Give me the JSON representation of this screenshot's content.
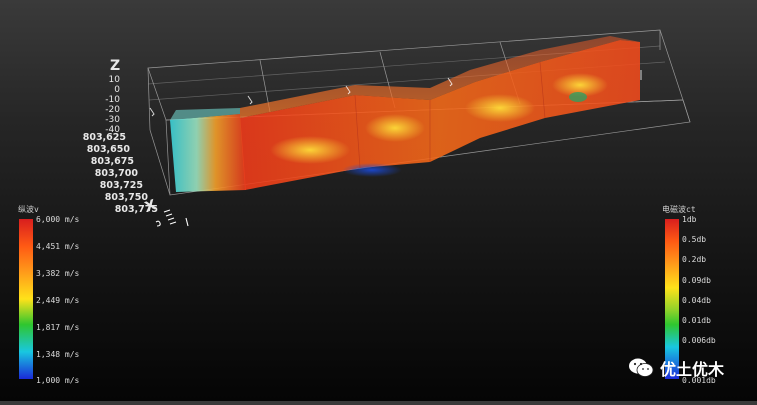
{
  "axes": {
    "z_label": "Z",
    "x_label": "X",
    "z_ticks": [
      "10",
      "0",
      "-10",
      "-20",
      "-30",
      "-40"
    ],
    "x_ticks": [
      "803,625",
      "803,650",
      "803,675",
      "803,700",
      "803,725",
      "803,750",
      "803,775"
    ]
  },
  "left_legend": {
    "title": "纵波v",
    "labels": [
      "6,000 m/s",
      "4,451 m/s",
      "3,382 m/s",
      "2,449 m/s",
      "1,817 m/s",
      "1,348 m/s",
      "1,000 m/s"
    ]
  },
  "right_legend": {
    "title": "电磁波ct",
    "labels": [
      "1db",
      "0.5db",
      "0.2db",
      "0.09db",
      "0.04db",
      "0.01db",
      "0.006db",
      "0.001db"
    ]
  },
  "watermark": {
    "text": "优土优木",
    "icon": "wechat-icon"
  },
  "colors": {
    "high": "#d81e1e",
    "mid_high": "#ff7a10",
    "mid": "#ffd21a",
    "mid_low": "#2fc62f",
    "low_mid": "#19c7e0",
    "low": "#1a2ad8"
  }
}
